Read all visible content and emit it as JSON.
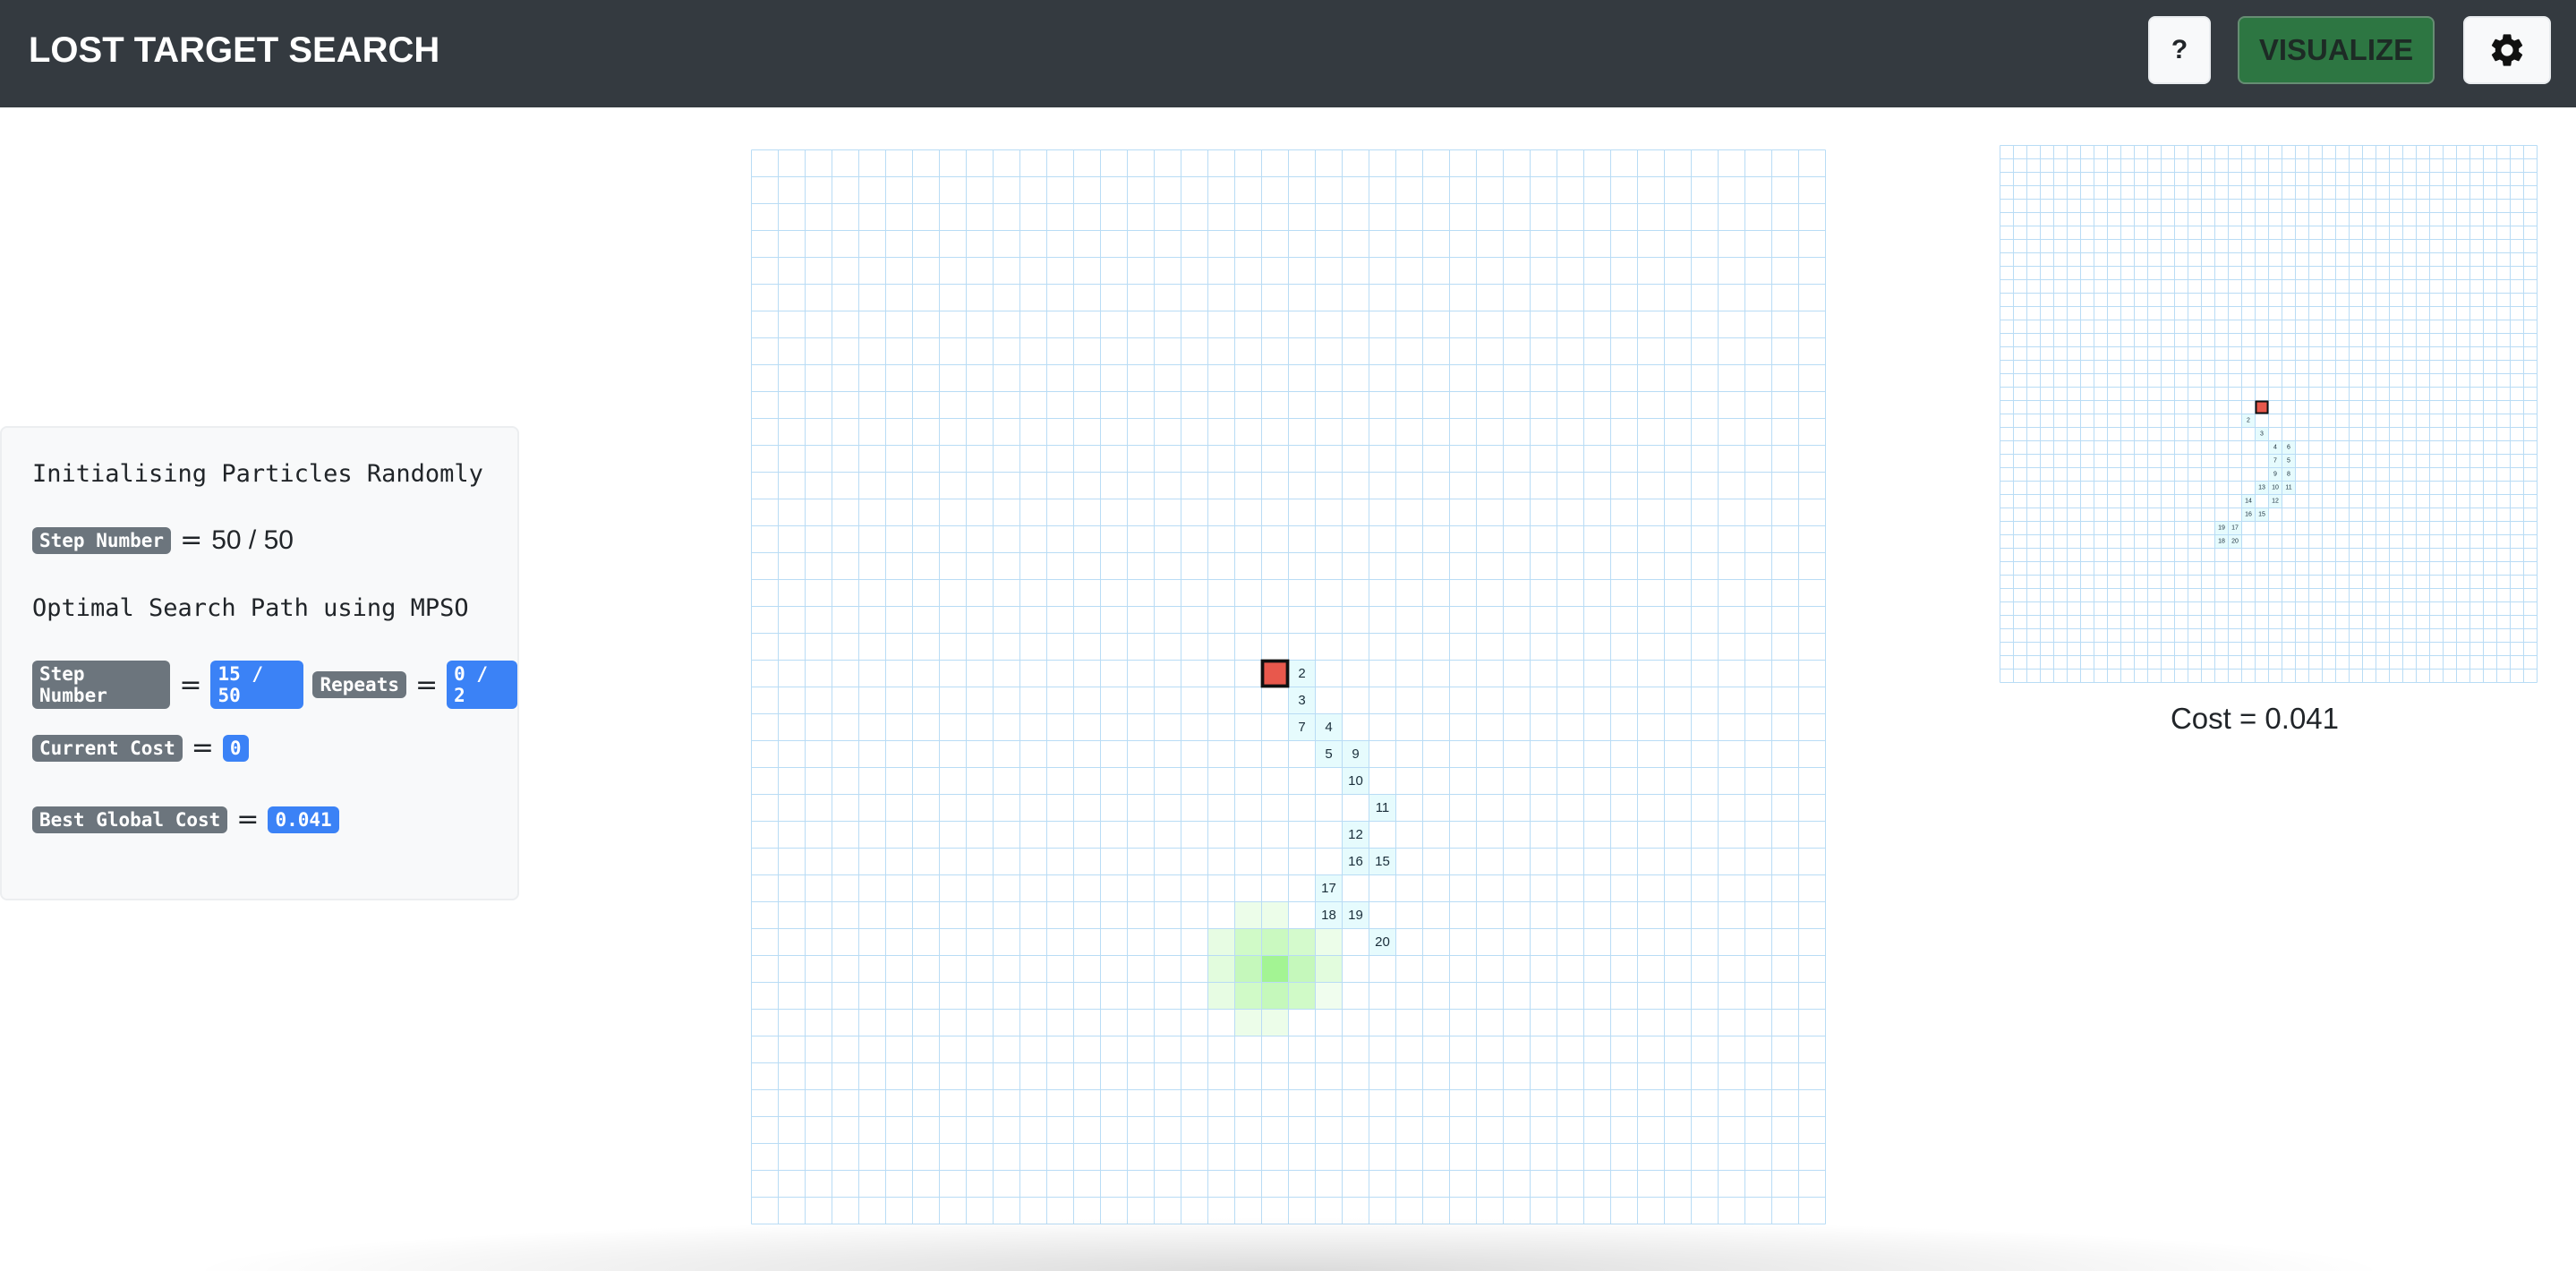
{
  "navbar": {
    "title": "LOST TARGET SEARCH",
    "help_label": "?",
    "visualize_label": "VISUALIZE",
    "settings_icon": "gear-icon"
  },
  "info": {
    "init_title": "Initialising Particles Randomly",
    "step_label": "Step Number",
    "init_step_value": "50 / 50",
    "mpso_title": "Optimal Search Path using MPSO",
    "mpso_step_value": "15 / 50",
    "repeats_label": "Repeats",
    "repeats_value": "0 / 2",
    "current_cost_label": "Current Cost",
    "current_cost_value": "0",
    "best_cost_label": "Best Global Cost",
    "best_cost_value": "0.041"
  },
  "grid": {
    "cols": 40,
    "rows": 40,
    "start_cell": [
      19,
      19
    ],
    "path_cells": [
      {
        "c": 20,
        "r": 19,
        "label": "2"
      },
      {
        "c": 20,
        "r": 20,
        "label": "3"
      },
      {
        "c": 21,
        "r": 21,
        "label": "4"
      },
      {
        "c": 21,
        "r": 22,
        "label": "5"
      },
      {
        "c": 20,
        "r": 21,
        "label": "7"
      },
      {
        "c": 22,
        "r": 22,
        "label": "9"
      },
      {
        "c": 22,
        "r": 23,
        "label": "10"
      },
      {
        "c": 23,
        "r": 24,
        "label": "11"
      },
      {
        "c": 22,
        "r": 25,
        "label": "12"
      },
      {
        "c": 23,
        "r": 26,
        "label": "15"
      },
      {
        "c": 22,
        "r": 26,
        "label": "16"
      },
      {
        "c": 21,
        "r": 27,
        "label": "17"
      },
      {
        "c": 21,
        "r": 28,
        "label": "18"
      },
      {
        "c": 22,
        "r": 28,
        "label": "19"
      },
      {
        "c": 23,
        "r": 29,
        "label": "20"
      }
    ],
    "heat_cells": [
      {
        "c": 18,
        "r": 28,
        "v": 0.2
      },
      {
        "c": 19,
        "r": 28,
        "v": 0.2
      },
      {
        "c": 17,
        "r": 29,
        "v": 0.25
      },
      {
        "c": 18,
        "r": 29,
        "v": 0.5
      },
      {
        "c": 19,
        "r": 29,
        "v": 0.55
      },
      {
        "c": 20,
        "r": 29,
        "v": 0.45
      },
      {
        "c": 21,
        "r": 29,
        "v": 0.2
      },
      {
        "c": 17,
        "r": 30,
        "v": 0.3
      },
      {
        "c": 18,
        "r": 30,
        "v": 0.6
      },
      {
        "c": 19,
        "r": 30,
        "v": 0.95
      },
      {
        "c": 20,
        "r": 30,
        "v": 0.6
      },
      {
        "c": 21,
        "r": 30,
        "v": 0.3
      },
      {
        "c": 17,
        "r": 31,
        "v": 0.25
      },
      {
        "c": 18,
        "r": 31,
        "v": 0.5
      },
      {
        "c": 19,
        "r": 31,
        "v": 0.6
      },
      {
        "c": 20,
        "r": 31,
        "v": 0.5
      },
      {
        "c": 21,
        "r": 31,
        "v": 0.15
      },
      {
        "c": 18,
        "r": 32,
        "v": 0.2
      },
      {
        "c": 19,
        "r": 32,
        "v": 0.2
      }
    ]
  },
  "mini_grid": {
    "cols": 40,
    "rows": 40,
    "start_cell": [
      19,
      19
    ],
    "path_cells": [
      {
        "c": 18,
        "r": 20,
        "label": "2"
      },
      {
        "c": 19,
        "r": 21,
        "label": "3"
      },
      {
        "c": 20,
        "r": 22,
        "label": "4"
      },
      {
        "c": 21,
        "r": 22,
        "label": "6"
      },
      {
        "c": 20,
        "r": 23,
        "label": "7"
      },
      {
        "c": 21,
        "r": 23,
        "label": "5"
      },
      {
        "c": 20,
        "r": 24,
        "label": "9"
      },
      {
        "c": 21,
        "r": 24,
        "label": "8"
      },
      {
        "c": 19,
        "r": 25,
        "label": "13"
      },
      {
        "c": 20,
        "r": 25,
        "label": "10"
      },
      {
        "c": 21,
        "r": 25,
        "label": "11"
      },
      {
        "c": 18,
        "r": 26,
        "label": "14"
      },
      {
        "c": 20,
        "r": 26,
        "label": "12"
      },
      {
        "c": 18,
        "r": 27,
        "label": "16"
      },
      {
        "c": 19,
        "r": 27,
        "label": "15"
      },
      {
        "c": 16,
        "r": 28,
        "label": "19"
      },
      {
        "c": 17,
        "r": 28,
        "label": "17"
      },
      {
        "c": 16,
        "r": 29,
        "label": "18"
      },
      {
        "c": 17,
        "r": 29,
        "label": "20"
      }
    ],
    "cost_text": "Cost = 0.041"
  },
  "colors": {
    "grid_line": "#b9dcf5",
    "start_fill": "#e8584c",
    "path_fill": "#e6fbfd",
    "heat_fill": "#8ef27a"
  }
}
